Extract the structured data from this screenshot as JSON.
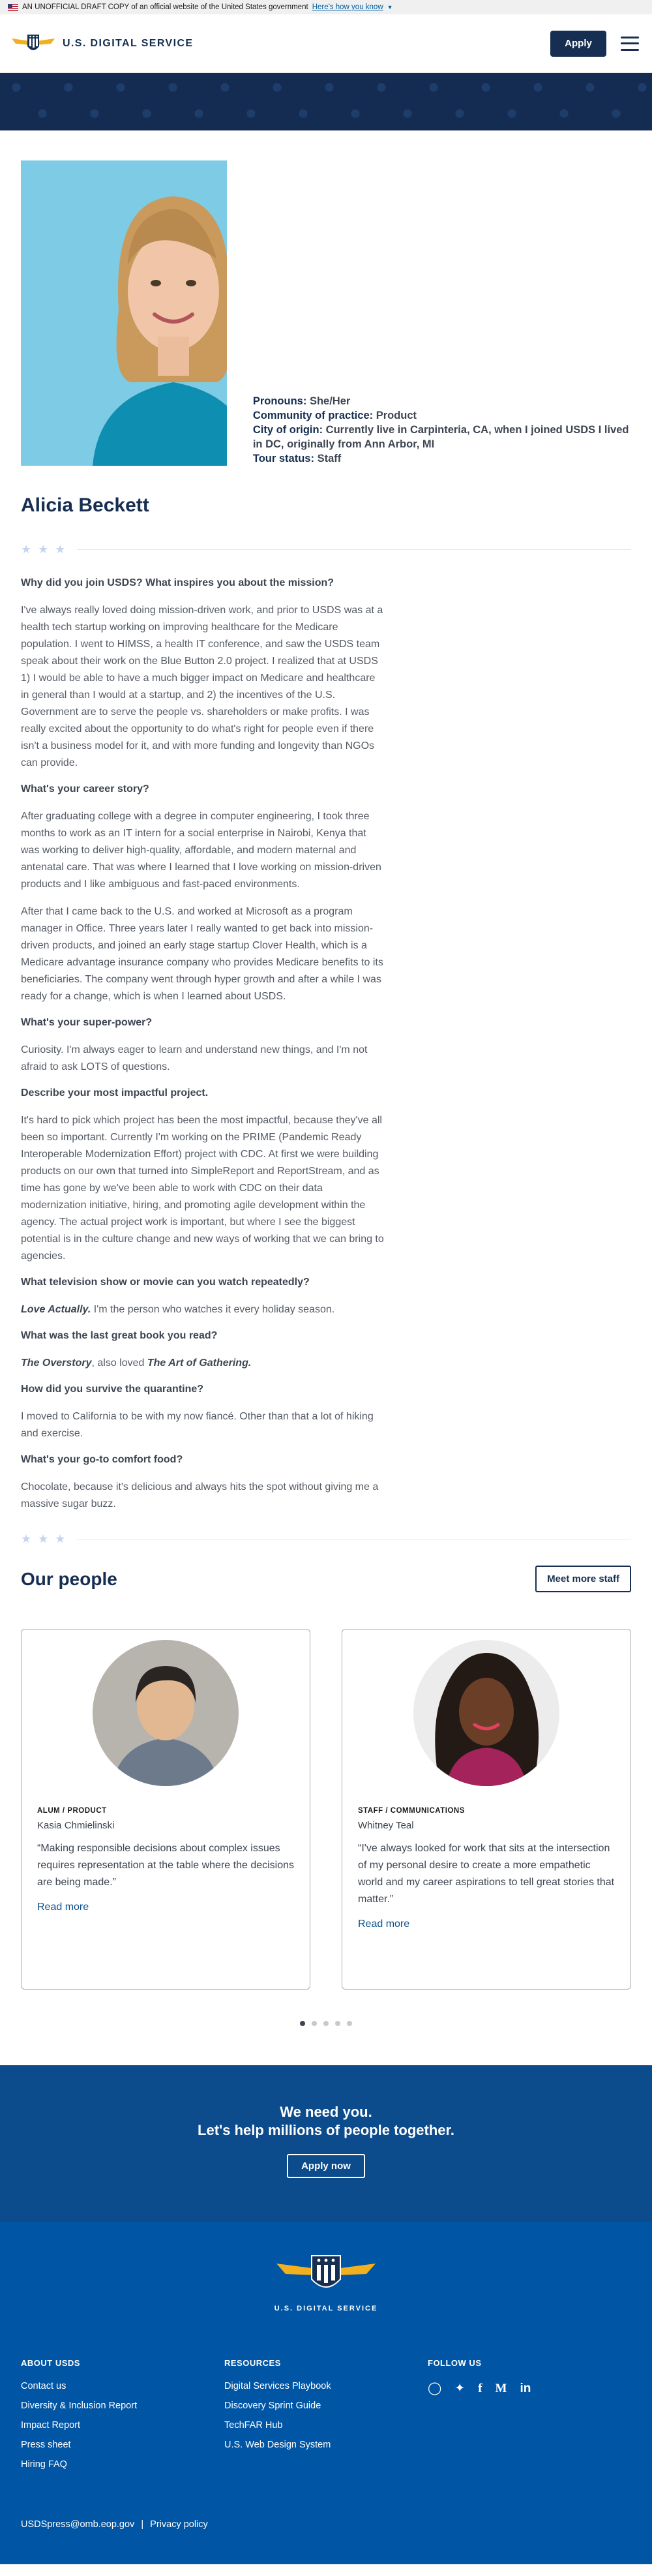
{
  "gov_banner": {
    "text": "AN UNOFFICIAL DRAFT COPY of an official website of the United States government",
    "link": "Here's how you know"
  },
  "header": {
    "logo_text": "U.S. DIGITAL SERVICE",
    "apply_label": "Apply"
  },
  "profile": {
    "pronouns_label": "Pronouns:",
    "pronouns": "She/Her",
    "community_label": "Community of practice:",
    "community": "Product",
    "origin_label": "City of origin:",
    "origin": "Currently live in Carpinteria, CA, when I joined USDS I lived in DC, originally from Ann Arbor, MI",
    "tour_label": "Tour status:",
    "tour": "Staff",
    "name": "Alicia Beckett"
  },
  "qa": [
    {
      "q": "Why did you join USDS? What inspires you about the mission?",
      "a": [
        "I've always really loved doing mission-driven work, and prior to USDS was at a health tech startup working on improving healthcare for the Medicare population. I went to HIMSS, a health IT conference, and saw the USDS team speak about their work on the Blue Button 2.0 project. I realized that at USDS 1) I would be able to have a much bigger impact on Medicare and healthcare in general than I would at a startup, and 2) the incentives of the U.S. Government are to serve the people vs. shareholders or make profits. I was really excited about the opportunity to do what's right for people even if there isn't a business model for it, and with more funding and longevity than NGOs can provide."
      ]
    },
    {
      "q": "What's your career story?",
      "a": [
        "After graduating college with a degree in computer engineering, I took three months to work as an IT intern for a social enterprise in Nairobi, Kenya that was working to deliver high-quality, affordable, and modern maternal and antenatal care. That was where I learned that I love working on mission-driven products and I like ambiguous and fast-paced environments.",
        "After that I came back to the U.S. and worked at Microsoft as a program manager in Office. Three years later I really wanted to get back into mission-driven products, and joined an early stage startup Clover Health, which is a Medicare advantage insurance company who provides Medicare benefits to its beneficiaries. The company went through hyper growth and after a while I was ready for a change, which is when I learned about USDS."
      ]
    },
    {
      "q": "What's your super-power?",
      "a": [
        "Curiosity. I'm always eager to learn and understand new things, and I'm not afraid to ask LOTS of questions."
      ]
    },
    {
      "q": "Describe your most impactful project.",
      "a": [
        "It's hard to pick which project has been the most impactful, because they've all been so important. Currently I'm working on the PRIME (Pandemic Ready Interoperable Modernization Effort) project with CDC. At first we were building products on our own that turned into SimpleReport and ReportStream, and as time has gone by we've been able to work with CDC on their data modernization initiative, hiring, and promoting agile development within the agency. The actual project work is important, but where I see the biggest potential is in the culture change and new ways of working that we can bring to agencies."
      ]
    },
    {
      "q": "What television show or movie can you watch repeatedly?",
      "em": "Love Actually.",
      "a_after": " I'm the person who watches it every holiday season."
    },
    {
      "q": "What was the last great book you read?",
      "em": "The Overstory",
      "a_mid": ", also loved ",
      "em2": "The Art of Gathering."
    },
    {
      "q": "How did you survive the quarantine?",
      "a": [
        "I moved to California to be with my now fiancé. Other than that a lot of hiking and exercise."
      ]
    },
    {
      "q": "What's your go-to comfort food?",
      "a": [
        "Chocolate, because it's delicious and always hits the spot without giving me a massive sugar buzz."
      ]
    }
  ],
  "people": {
    "title": "Our people",
    "meet_label": "Meet more staff",
    "cards": [
      {
        "tag": "ALUM / PRODUCT",
        "name": "Kasia Chmielinski",
        "quote": "“Making responsible decisions about complex issues requires representation at the table where the decisions are being made.”",
        "link": "Read more"
      },
      {
        "tag": "STAFF / COMMUNICATIONS",
        "name": "Whitney Teal",
        "quote": "“I've always looked for work that sits at the intersection of my personal desire to create a more empathetic world and my career aspirations to tell great stories that matter.”",
        "link": "Read more"
      }
    ],
    "dots_count": 5,
    "active_dot": 1
  },
  "cta": {
    "line1": "We need you.",
    "line2": "Let's help millions of people together.",
    "button": "Apply now"
  },
  "footer": {
    "logo_text": "U.S. DIGITAL SERVICE",
    "about": {
      "title": "ABOUT USDS",
      "links": [
        "Contact us",
        "Diversity & Inclusion Report",
        "Impact Report",
        "Press sheet",
        "Hiring FAQ"
      ]
    },
    "resources": {
      "title": "RESOURCES",
      "links": [
        "Digital Services Playbook",
        "Discovery Sprint Guide",
        "TechFAR Hub",
        "U.S. Web Design System"
      ]
    },
    "follow": {
      "title": "FOLLOW US",
      "icons": [
        "instagram-icon",
        "twitter-icon",
        "facebook-icon",
        "medium-icon",
        "linkedin-icon"
      ]
    },
    "email": "USDSpress@omb.eop.gov",
    "separator": "|",
    "privacy": "Privacy policy"
  },
  "colors": {
    "navy": "#162e51",
    "footer_blue": "#0055a4",
    "cta_blue": "#0c4b8c",
    "photo_bg": "#7ecbe5"
  }
}
